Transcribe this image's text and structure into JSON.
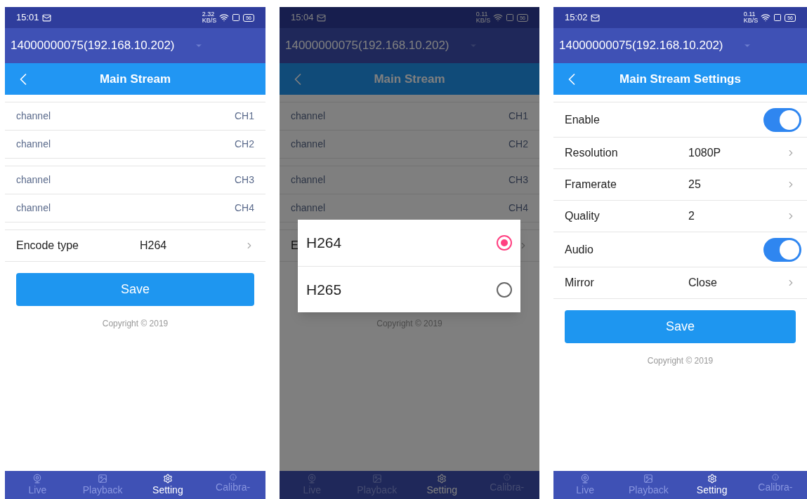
{
  "phones": [
    {
      "status": {
        "time": "15:01",
        "speed": "2.32",
        "speed_unit": "KB/S",
        "battery": "56"
      },
      "device": "14000000075(192.168.10.202)",
      "title": "Main Stream",
      "sections": [
        [
          {
            "kind": "channel",
            "label": "channel",
            "value": "CH1"
          },
          {
            "kind": "channel",
            "label": "channel",
            "value": "CH2"
          }
        ],
        [
          {
            "kind": "channel",
            "label": "channel",
            "value": "CH3"
          },
          {
            "kind": "channel",
            "label": "channel",
            "value": "CH4"
          }
        ],
        [
          {
            "kind": "select",
            "label": "Encode type",
            "value": "H264"
          }
        ]
      ],
      "save": "Save",
      "copyright": "Copyright © 2019",
      "nav": [
        {
          "label": "Live",
          "selected": false
        },
        {
          "label": "Playback",
          "selected": false
        },
        {
          "label": "Setting",
          "selected": true
        },
        {
          "label": "Calibra-",
          "selected": false
        }
      ]
    },
    {
      "status": {
        "time": "15:04",
        "speed": "0.11",
        "speed_unit": "KB/S",
        "battery": "56"
      },
      "device": "14000000075(192.168.10.202)",
      "title": "Main Stream",
      "sections": [
        [
          {
            "kind": "channel",
            "label": "channel",
            "value": "CH1"
          },
          {
            "kind": "channel",
            "label": "channel",
            "value": "CH2"
          }
        ],
        [
          {
            "kind": "channel",
            "label": "channel",
            "value": "CH3"
          },
          {
            "kind": "channel",
            "label": "channel",
            "value": "CH4"
          }
        ],
        [
          {
            "kind": "select",
            "label": "E"
          }
        ]
      ],
      "copyright": "Copyright © 2019",
      "nav": [
        {
          "label": "Live",
          "selected": false
        },
        {
          "label": "Playback",
          "selected": false
        },
        {
          "label": "Setting",
          "selected": true
        },
        {
          "label": "Calibra-",
          "selected": false
        }
      ],
      "dialog": {
        "options": [
          {
            "label": "H264",
            "selected": true
          },
          {
            "label": "H265",
            "selected": false
          }
        ]
      }
    },
    {
      "status": {
        "time": "15:02",
        "speed": "0.11",
        "speed_unit": "KB/S",
        "battery": "56"
      },
      "device": "14000000075(192.168.10.202)",
      "title": "Main Stream Settings",
      "sections": [
        [
          {
            "kind": "toggle",
            "label": "Enable",
            "on": true
          },
          {
            "kind": "setting",
            "label": "Resolution",
            "value": "1080P"
          },
          {
            "kind": "setting",
            "label": "Framerate",
            "value": "25"
          },
          {
            "kind": "setting",
            "label": "Quality",
            "value": "2"
          },
          {
            "kind": "toggle",
            "label": "Audio",
            "on": true
          },
          {
            "kind": "setting",
            "label": "Mirror",
            "value": "Close"
          }
        ]
      ],
      "save": "Save",
      "copyright": "Copyright © 2019",
      "nav": [
        {
          "label": "Live",
          "selected": false
        },
        {
          "label": "Playback",
          "selected": false
        },
        {
          "label": "Setting",
          "selected": true
        },
        {
          "label": "Calibra-",
          "selected": false
        }
      ]
    }
  ]
}
